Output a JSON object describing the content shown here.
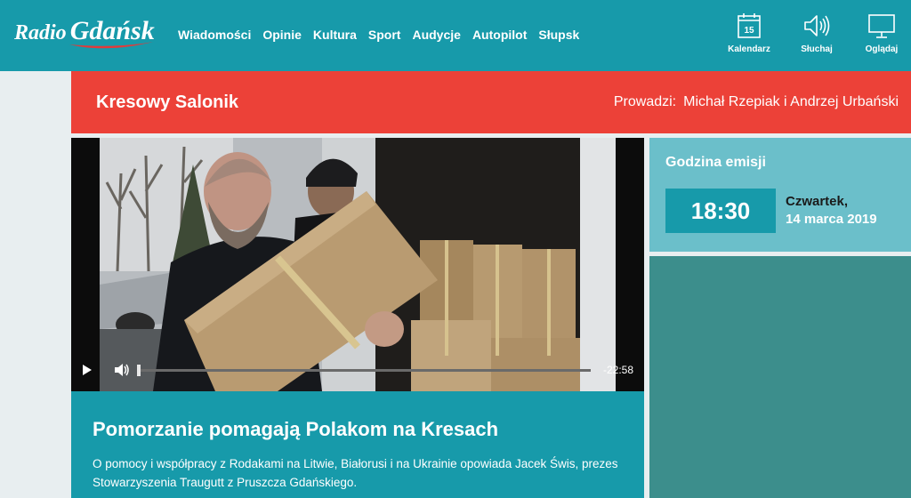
{
  "header": {
    "logo_word1": "Radio",
    "logo_word2": "Gdańsk",
    "nav": [
      "Wiadomości",
      "Opinie",
      "Kultura",
      "Sport",
      "Audycje",
      "Autopilot",
      "Słupsk"
    ],
    "tools": {
      "calendar_day": "15",
      "calendar_label": "Kalendarz",
      "listen_label": "Słuchaj",
      "watch_label": "Oglądaj"
    }
  },
  "program": {
    "title": "Kresowy Salonik",
    "hosts_prefix": "Prowadzi:",
    "hosts": "Michał Rzepiak i Andrzej Urbański"
  },
  "player": {
    "time_remaining": "-22:58",
    "progress": 0.0
  },
  "article": {
    "title": "Pomorzanie pomagają Polakom na Kresach",
    "description": "O pomocy i współpracy z Rodakami na Litwie, Białorusi i na Ukrainie opowiada Jacek Świs, prezes Stowarzyszenia Traugutt z Pruszcza Gdańskiego."
  },
  "air": {
    "label": "Godzina emisji",
    "time": "18:30",
    "day": "Czwartek,",
    "date": "14 marca 2019"
  },
  "colors": {
    "teal": "#179aaa",
    "red": "#ec4138",
    "light_teal": "#6bbfca",
    "dark_teal": "#3c8e8c"
  },
  "icons": {
    "calendar": "calendar-icon",
    "listen": "speaker-icon",
    "watch": "monitor-icon",
    "play": "play-icon",
    "volume": "volume-icon"
  }
}
